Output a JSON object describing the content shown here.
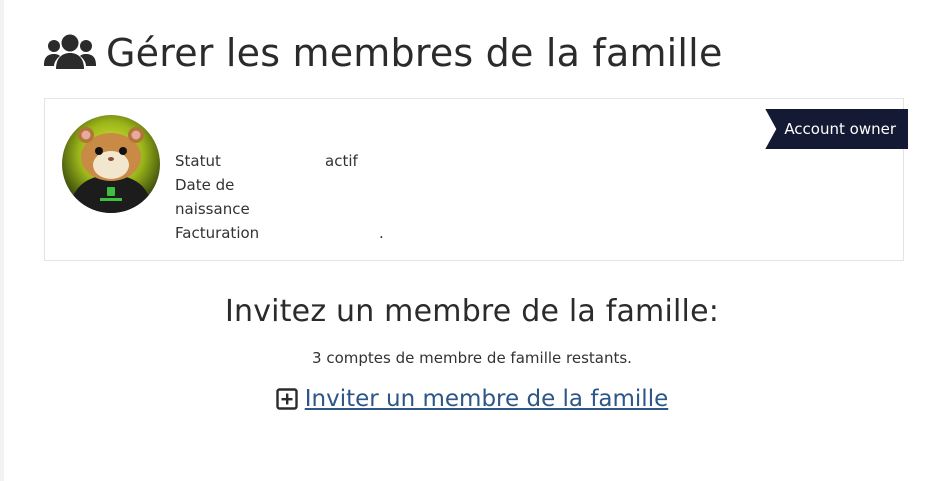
{
  "header": {
    "title": "Gérer les membres de la famille",
    "icon": "users-icon"
  },
  "member": {
    "badge": "Account owner",
    "avatar": "hamster-avatar",
    "rows": [
      {
        "label": "Statut",
        "value": "actif"
      },
      {
        "label": "Date de naissance",
        "value": ""
      },
      {
        "label": "Facturation",
        "value": "."
      }
    ]
  },
  "invite": {
    "title": "Invitez un membre de la famille:",
    "remaining": "3 comptes de membre de famille restants.",
    "link_label": "Inviter un membre de la famille",
    "link_icon": "plus-square-icon"
  },
  "colors": {
    "badge_bg": "#141a33",
    "link": "#2d5688",
    "card_border": "#e4e4e4"
  }
}
